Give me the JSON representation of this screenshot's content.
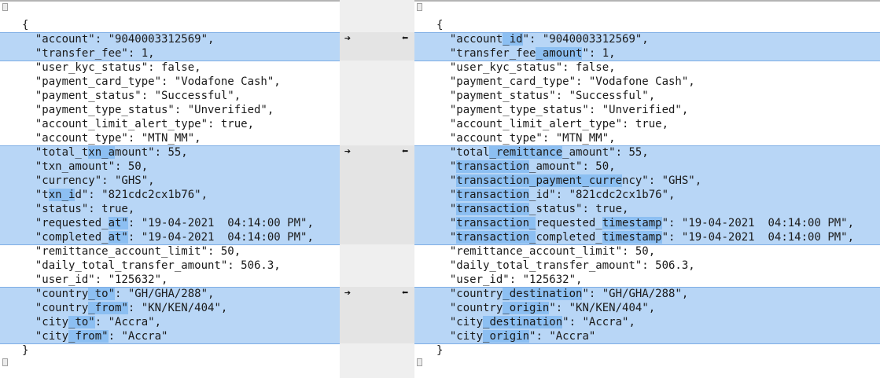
{
  "left": {
    "lines": [
      "{",
      "  \"account\": \"9040003312569\",",
      "  \"transfer_fee\": 1,",
      "  \"user_kyc_status\": false,",
      "  \"payment_card_type\": \"Vodafone Cash\",",
      "  \"payment_status\": \"Successful\",",
      "  \"payment_type_status\": \"Unverified\",",
      "  \"account_limit_alert_type\": true,",
      "  \"account_type\": \"MTN_MM\",",
      "  \"total_txn_amount\": 55,",
      "  \"txn_amount\": 50,",
      "  \"currency\": \"GHS\",",
      "  \"txn_id\": \"821cdc2cx1b76\",",
      "  \"status\": true,",
      "  \"requested_at\": \"19-04-2021  04:14:00 PM\",",
      "  \"completed_at\": \"19-04-2021  04:14:00 PM\",",
      "  \"remittance_account_limit\": 50,",
      "  \"daily_total_transfer_amount\": 506.3,",
      "  \"user_id\": \"125632\",",
      "  \"country_to\": \"GH/GHA/288\",",
      "  \"country_from\": \"KN/KEN/404\",",
      "  \"city_to\": \"Accra\",",
      "  \"city_from\": \"Accra\"",
      "}"
    ]
  },
  "right": {
    "lines": [
      "{",
      "  \"account_id\": \"9040003312569\",",
      "  \"transfer_fee_amount\": 1,",
      "  \"user_kyc_status\": false,",
      "  \"payment_card_type\": \"Vodafone Cash\",",
      "  \"payment_status\": \"Successful\",",
      "  \"payment_type_status\": \"Unverified\",",
      "  \"account_limit_alert_type\": true,",
      "  \"account_type\": \"MTN_MM\",",
      "  \"total_remittance_amount\": 55,",
      "  \"transaction_amount\": 50,",
      "  \"transaction_payment_currency\": \"GHS\",",
      "  \"transaction_id\": \"821cdc2cx1b76\",",
      "  \"transaction_status\": true,",
      "  \"transaction_requested_timestamp\": \"19-04-2021  04:14:00 PM\",",
      "  \"transaction_completed_timestamp\": \"19-04-2021  04:14:00 PM\",",
      "  \"remittance_account_limit\": 50,",
      "  \"daily_total_transfer_amount\": 506.3,",
      "  \"user_id\": \"125632\",",
      "  \"country_destination\": \"GH/GHA/288\",",
      "  \"country_origin\": \"KN/KEN/404\",",
      "  \"city_destination\": \"Accra\",",
      "  \"city_origin\": \"Accra\"",
      "}"
    ]
  },
  "changes": [
    {
      "start": 1,
      "end": 2
    },
    {
      "start": 9,
      "end": 15
    },
    {
      "start": 19,
      "end": 22
    }
  ],
  "highlights": {
    "left": {
      "9": [
        [
          10,
          14
        ]
      ],
      "12": [
        [
          4,
          8
        ]
      ],
      "14": [
        [
          13,
          16
        ]
      ],
      "15": [
        [
          13,
          16
        ]
      ],
      "19": [
        [
          10,
          14
        ]
      ],
      "20": [
        [
          10,
          16
        ]
      ],
      "21": [
        [
          7,
          11
        ]
      ],
      "22": [
        [
          7,
          13
        ]
      ]
    },
    "right": {
      "1": [
        [
          10,
          13
        ]
      ],
      "2": [
        [
          15,
          22
        ]
      ],
      "9": [
        [
          8,
          19
        ]
      ],
      "10": [
        [
          3,
          14
        ]
      ],
      "11": [
        [
          3,
          28
        ]
      ],
      "12": [
        [
          3,
          14
        ]
      ],
      "13": [
        [
          3,
          14
        ]
      ],
      "14": [
        [
          3,
          15
        ],
        [
          25,
          34
        ]
      ],
      "15": [
        [
          3,
          15
        ],
        [
          25,
          34
        ]
      ],
      "19": [
        [
          10,
          22
        ]
      ],
      "20": [
        [
          10,
          17
        ]
      ],
      "21": [
        [
          7,
          19
        ]
      ],
      "22": [
        [
          7,
          14
        ]
      ]
    }
  },
  "icons": {
    "copy_right": "right-arrow-icon",
    "copy_left": "left-arrow-icon"
  },
  "colors": {
    "changed_background": "#b8d6f6",
    "inline_highlight": "#8cbff2",
    "gutter": "#efefef"
  }
}
